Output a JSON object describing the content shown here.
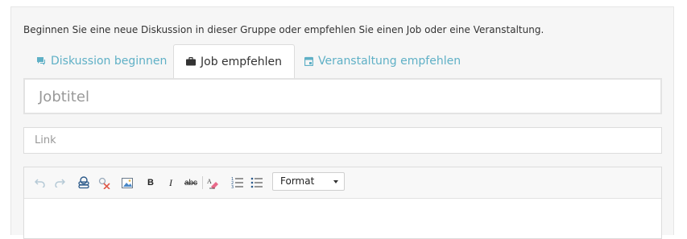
{
  "intro": "Beginnen Sie eine neue Diskussion in dieser Gruppe oder empfehlen Sie einen Job oder eine Veranstaltung.",
  "tabs": [
    {
      "label": "Diskussion beginnen",
      "icon": "chat-icon"
    },
    {
      "label": "Job empfehlen",
      "icon": "briefcase-icon",
      "active": true
    },
    {
      "label": "Veranstaltung empfehlen",
      "icon": "calendar-icon"
    }
  ],
  "form": {
    "title_placeholder": "Jobtitel",
    "link_placeholder": "Link"
  },
  "toolbar": {
    "bold": "B",
    "italic": "I",
    "strike": "abc",
    "format_label": "Format"
  },
  "colors": {
    "accent": "#5fb0c6",
    "panel": "#f6f6f6",
    "border": "#dcdcdc"
  }
}
